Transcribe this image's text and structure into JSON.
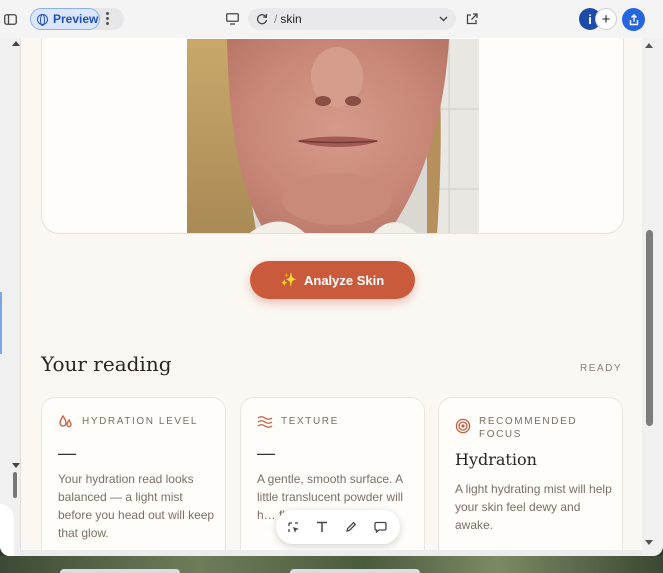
{
  "toolbar": {
    "preview_label": "Preview",
    "url_path": "skin",
    "avatar_letter": "i",
    "plus_label": "+"
  },
  "page": {
    "analyze_label": "Analyze Skin",
    "reading_title": "Your reading",
    "status": "READY"
  },
  "cards": [
    {
      "icon": "droplets-icon",
      "label": "HYDRATION LEVEL",
      "value": "—",
      "body": "Your hydration read looks balanced — a light mist before you head out will keep that glow."
    },
    {
      "icon": "waves-icon",
      "label": "TEXTURE",
      "value": "—",
      "body": "A gentle, smooth surface. A little translucent powder will h… flas…"
    },
    {
      "icon": "target-icon",
      "label": "RECOMMENDED FOCUS",
      "value": "Hydration",
      "body": "A light hydrating mist will help your skin feel dewy and awake."
    }
  ],
  "colors": {
    "accent": "#c95b3c",
    "page_bg": "#fbf8f4",
    "preview_blue": "#1f4fb8"
  }
}
